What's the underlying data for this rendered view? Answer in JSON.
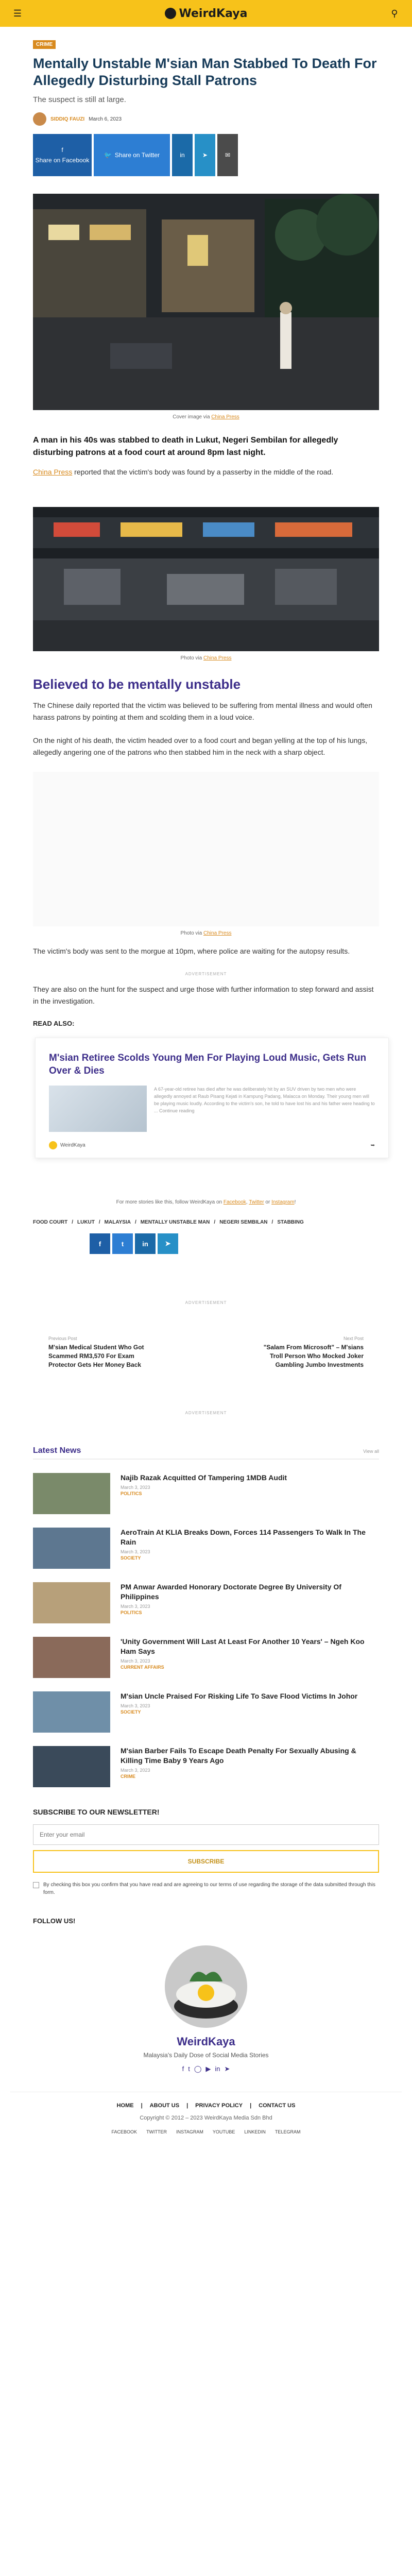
{
  "brand": {
    "name": "WeirdKaya"
  },
  "article": {
    "category": "Crime",
    "title": "Mentally Unstable M'sian Man Stabbed To Death For Allegedly Disturbing Stall Patrons",
    "subtitle": "The suspect is still at large.",
    "author": "Siddiq Fauzi",
    "date": "March 6, 2023",
    "share": {
      "facebook": "Share on Facebook",
      "twitter": "Share on Twitter"
    },
    "image1_caption_prefix": "Cover image via ",
    "image_source": "China Press",
    "lead": "A man in his 40s was stabbed to death in Lukut, Negeri Sembilan for allegedly disturbing patrons at a food court at around 8pm last night.",
    "p1_link": "China Press",
    "p1_rest": " reported that the victim's body was found by a passerby in the middle of the road.",
    "photo_caption_prefix": "Photo via ",
    "heading": "Believed to be mentally unstable",
    "p2": "The Chinese daily reported that the victim was believed to be suffering from mental illness and would often harass patrons by pointing at them and scolding them in a loud voice.",
    "p3": "On the night of his death, the victim headed over to a food court and began yelling at the top of his lungs, allegedly angering one of the patrons who then stabbed him in the neck with a sharp object.",
    "p4": "The victim's body was sent to the morgue at 10pm, where police are waiting for the autopsy results.",
    "p5": "They are also on the hunt for the suspect and urge those with further information to step forward and assist in the investigation.",
    "advertisement": "ADVERTISEMENT"
  },
  "read_also": {
    "label": "Read also:",
    "title": "M'sian Retiree Scolds Young Men For Playing Loud Music, Gets Run Over & Dies",
    "excerpt": "A 67-year-old retiree has died after he was deliberately hit by an SUV driven by two men who were allegedly annoyed at Raub Pisang Kejati in Kampung Padang, Malacca on Monday. Their young men will be playing music loudly. According to the victim's son, he told to have lost his and his father were heading to ... Continue reading",
    "source": "WeirdKaya"
  },
  "follow": {
    "text_prefix": "For more stories like this, follow WeirdKaya on ",
    "facebook": "Facebook",
    "sep1": ", ",
    "twitter": "Twitter",
    "sep2": " or ",
    "instagram": "Instagram",
    "suffix": "!"
  },
  "tags": [
    "Food Court",
    "Lukut",
    "Malaysia",
    "Mentally Unstable Man",
    "Negeri Sembilan",
    "Stabbing"
  ],
  "postnav": {
    "prev_label": "Previous Post",
    "prev_title": "M'sian Medical Student Who Got Scammed RM3,570 For Exam Protector Gets Her Money Back",
    "next_label": "Next Post",
    "next_title": "\"Salam From Microsoft\" – M'sians Troll Person Who Mocked Joker Gambling Jumbo Investments"
  },
  "latest": {
    "title": "Latest News",
    "view_all": "View all",
    "items": [
      {
        "title": "Najib Razak Acquitted Of Tampering 1MDB Audit",
        "date": "March 3, 2023",
        "category": "Politics",
        "color": "#7a8a6a"
      },
      {
        "title": "AeroTrain At KLIA Breaks Down, Forces 114 Passengers To Walk In The Rain",
        "date": "March 3, 2023",
        "category": "Society",
        "color": "#5d7790"
      },
      {
        "title": "PM Anwar Awarded Honorary Doctorate Degree By University Of Philippines",
        "date": "March 3, 2023",
        "category": "Politics",
        "color": "#b7a07a"
      },
      {
        "title": "'Unity Government Will Last At Least For Another 10 Years' – Ngeh Koo Ham Says",
        "date": "March 3, 2023",
        "category": "Current Affairs",
        "color": "#8a6a5a"
      },
      {
        "title": "M'sian Uncle Praised For Risking Life To Save Flood Victims In Johor",
        "date": "March 3, 2023",
        "category": "Society",
        "color": "#6f8fa8"
      },
      {
        "title": "M'sian Barber Fails To Escape Death Penalty For Sexually Abusing & Killing Time Baby 9 Years Ago",
        "date": "March 3, 2023",
        "category": "Crime",
        "color": "#3a4a5a"
      }
    ]
  },
  "newsletter": {
    "title": "Subscribe to our newsletter!",
    "placeholder": "Enter your email",
    "button": "Subscribe",
    "consent": "By checking this box you confirm that you have read and are agreeing to our terms of use regarding the storage of the data submitted through this form."
  },
  "follow_us": "Follow us!",
  "footer": {
    "name": "WeirdKaya",
    "tagline": "Malaysia's Daily Dose of Social Media Stories",
    "nav": [
      "Home",
      "About Us",
      "Privacy Policy",
      "Contact Us"
    ],
    "copyright": "Copyright © 2012 – 2023 WeirdKaya Media Sdn Bhd",
    "links": [
      "Facebook",
      "Twitter",
      "Instagram",
      "YouTube",
      "LinkedIn",
      "Telegram"
    ]
  }
}
